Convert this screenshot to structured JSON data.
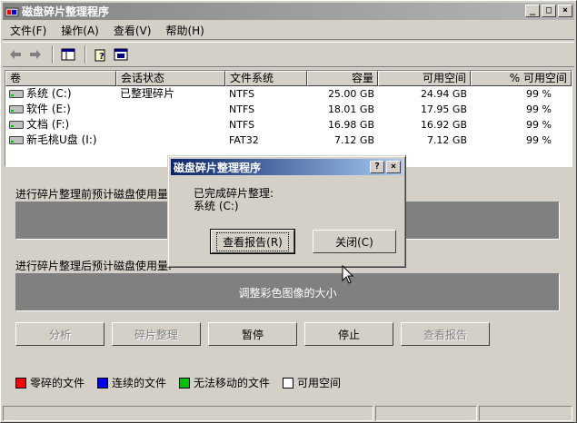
{
  "window": {
    "title": "磁盘碎片整理程序"
  },
  "menu": [
    {
      "label": "文件(F)"
    },
    {
      "label": "操作(A)"
    },
    {
      "label": "查看(V)"
    },
    {
      "label": "帮助(H)"
    }
  ],
  "columns": {
    "volume": "卷",
    "session": "会话状态",
    "fs": "文件系统",
    "capacity": "容量",
    "free": "可用空间",
    "pct": "% 可用空间"
  },
  "rows": [
    {
      "volume": "系统 (C:)",
      "session": "已整理碎片",
      "fs": "NTFS",
      "capacity": "25.00 GB",
      "free": "24.94 GB",
      "pct": "99 %"
    },
    {
      "volume": "软件 (E:)",
      "session": "",
      "fs": "NTFS",
      "capacity": "18.01 GB",
      "free": "17.95 GB",
      "pct": "99 %"
    },
    {
      "volume": "文档 (F:)",
      "session": "",
      "fs": "NTFS",
      "capacity": "16.98 GB",
      "free": "16.92 GB",
      "pct": "99 %"
    },
    {
      "volume": "新毛桃U盘 (I:)",
      "session": "",
      "fs": "FAT32",
      "capacity": "7.12 GB",
      "free": "7.12 GB",
      "pct": "99 %"
    }
  ],
  "before_label": "进行碎片整理前预计磁盘使用量:",
  "after_label": "进行碎片整理后预计磁盘使用量:",
  "after_bar_text": "调整彩色图像的大小",
  "buttons": {
    "analyze": "分析",
    "defrag": "碎片整理",
    "pause": "暂停",
    "stop": "停止",
    "report": "查看报告"
  },
  "legend": [
    {
      "label": "零碎的文件",
      "color": "#ff0000"
    },
    {
      "label": "连续的文件",
      "color": "#0000ff"
    },
    {
      "label": "无法移动的文件",
      "color": "#00c000"
    },
    {
      "label": "可用空间",
      "color": "#ffffff"
    }
  ],
  "dialog": {
    "title": "磁盘碎片整理程序",
    "line1": "已完成碎片整理:",
    "line2": "系统 (C:)",
    "report_button": "查看报告(R)",
    "close_button": "关闭(C)"
  }
}
